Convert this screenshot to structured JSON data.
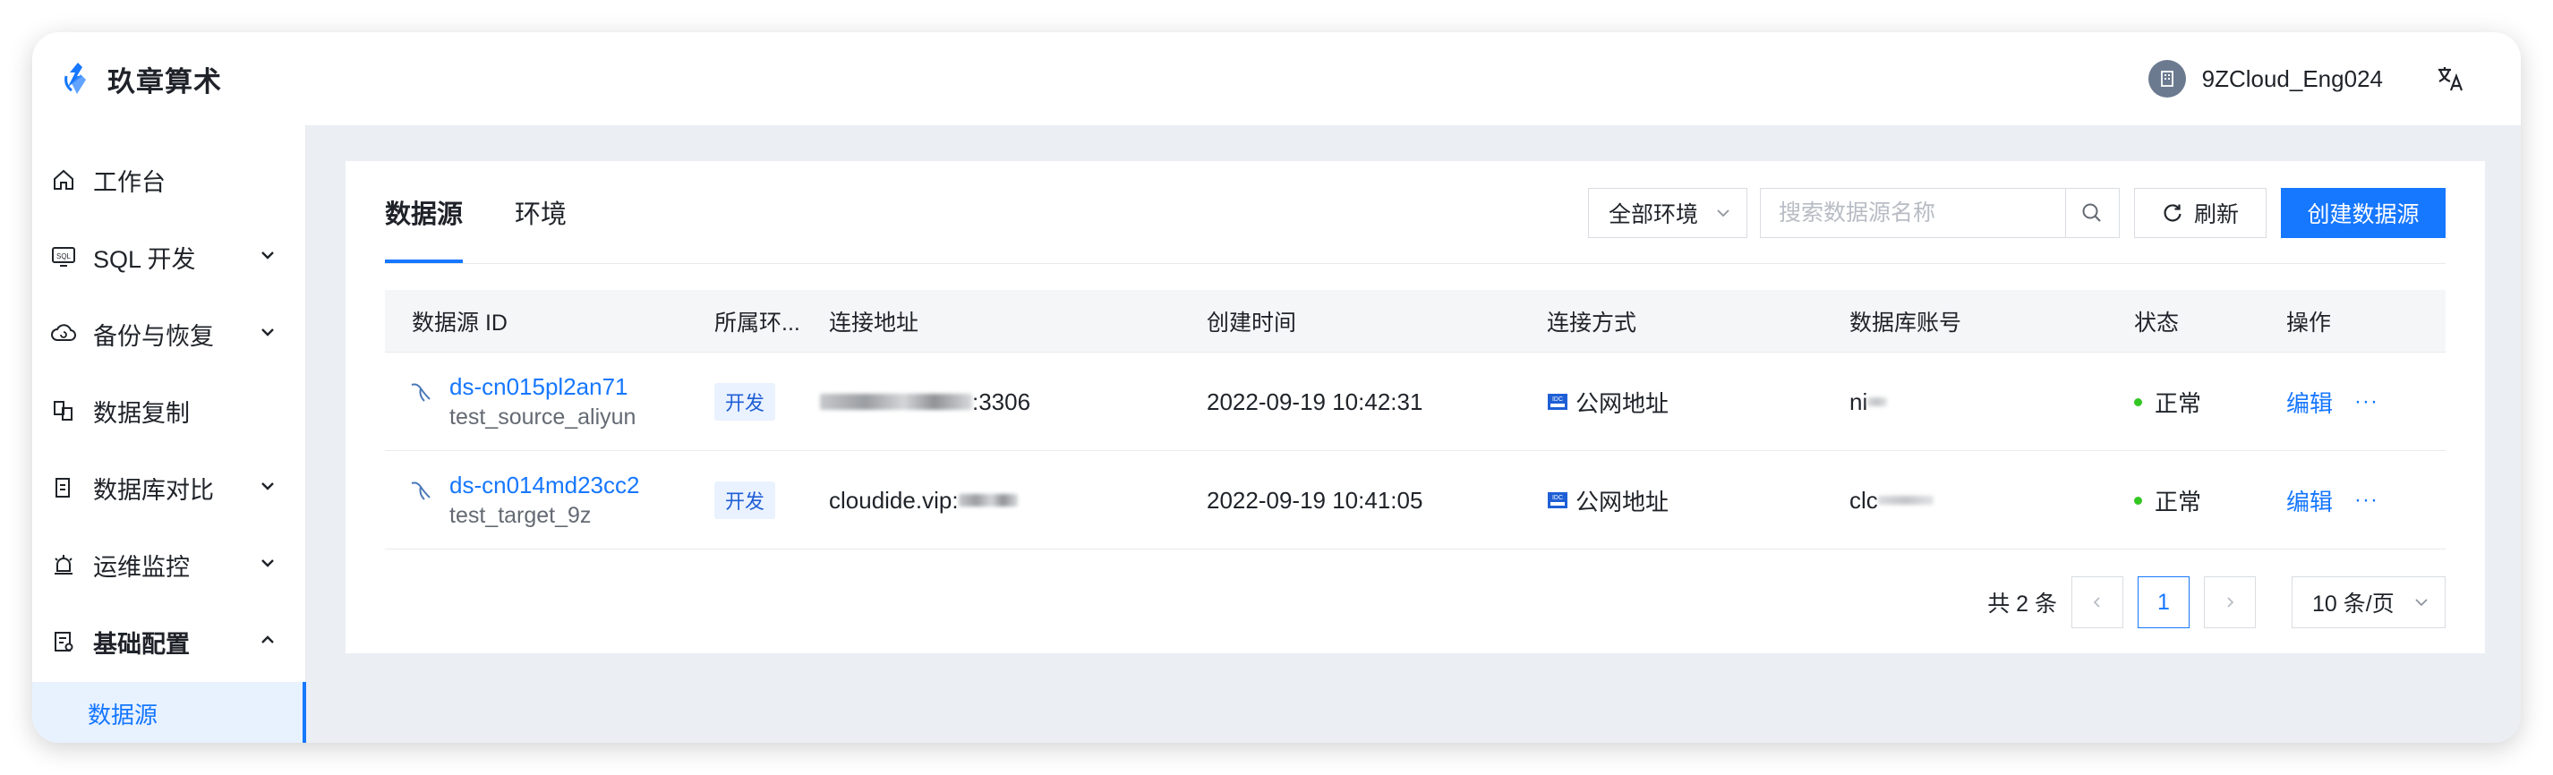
{
  "header": {
    "brand": "玖章算术",
    "username": "9ZCloud_Eng024"
  },
  "sidebar": {
    "items": [
      {
        "label": "工作台",
        "icon": "home-icon"
      },
      {
        "label": "SQL 开发",
        "icon": "sql-icon"
      },
      {
        "label": "备份与恢复",
        "icon": "backup-icon"
      },
      {
        "label": "数据复制",
        "icon": "replicate-icon"
      },
      {
        "label": "数据库对比",
        "icon": "compare-icon"
      },
      {
        "label": "运维监控",
        "icon": "alarm-icon"
      },
      {
        "label": "基础配置",
        "icon": "config-icon"
      }
    ],
    "active_sub": "数据源"
  },
  "tabs": [
    "数据源",
    "环境"
  ],
  "toolbar": {
    "env_filter": "全部环境",
    "search_placeholder": "搜索数据源名称",
    "refresh_label": "刷新",
    "create_label": "创建数据源"
  },
  "table": {
    "columns": [
      "数据源 ID",
      "所属环...",
      "连接地址",
      "创建时间",
      "连接方式",
      "数据库账号",
      "状态",
      "操作"
    ],
    "rows": [
      {
        "id": "ds-cn015pl2an71",
        "name": "test_source_aliyun",
        "env": "开发",
        "address_suffix": ":3306",
        "created": "2022-09-19 10:42:31",
        "connection": "公网地址",
        "account_prefix": "ni",
        "status": "正常",
        "action": "编辑",
        "more": "···"
      },
      {
        "id": "ds-cn014md23cc2",
        "name": "test_target_9z",
        "env": "开发",
        "address_prefix": "cloudide.vip:",
        "created": "2022-09-19 10:41:05",
        "connection": "公网地址",
        "account_prefix": "clc",
        "status": "正常",
        "action": "编辑",
        "more": "···"
      }
    ]
  },
  "pagination": {
    "total": "共 2 条",
    "current": "1",
    "page_size": "10 条/页"
  },
  "colors": {
    "accent": "#1677ff",
    "status_ok": "#34c724",
    "tag_bg": "#eaf2ff"
  }
}
